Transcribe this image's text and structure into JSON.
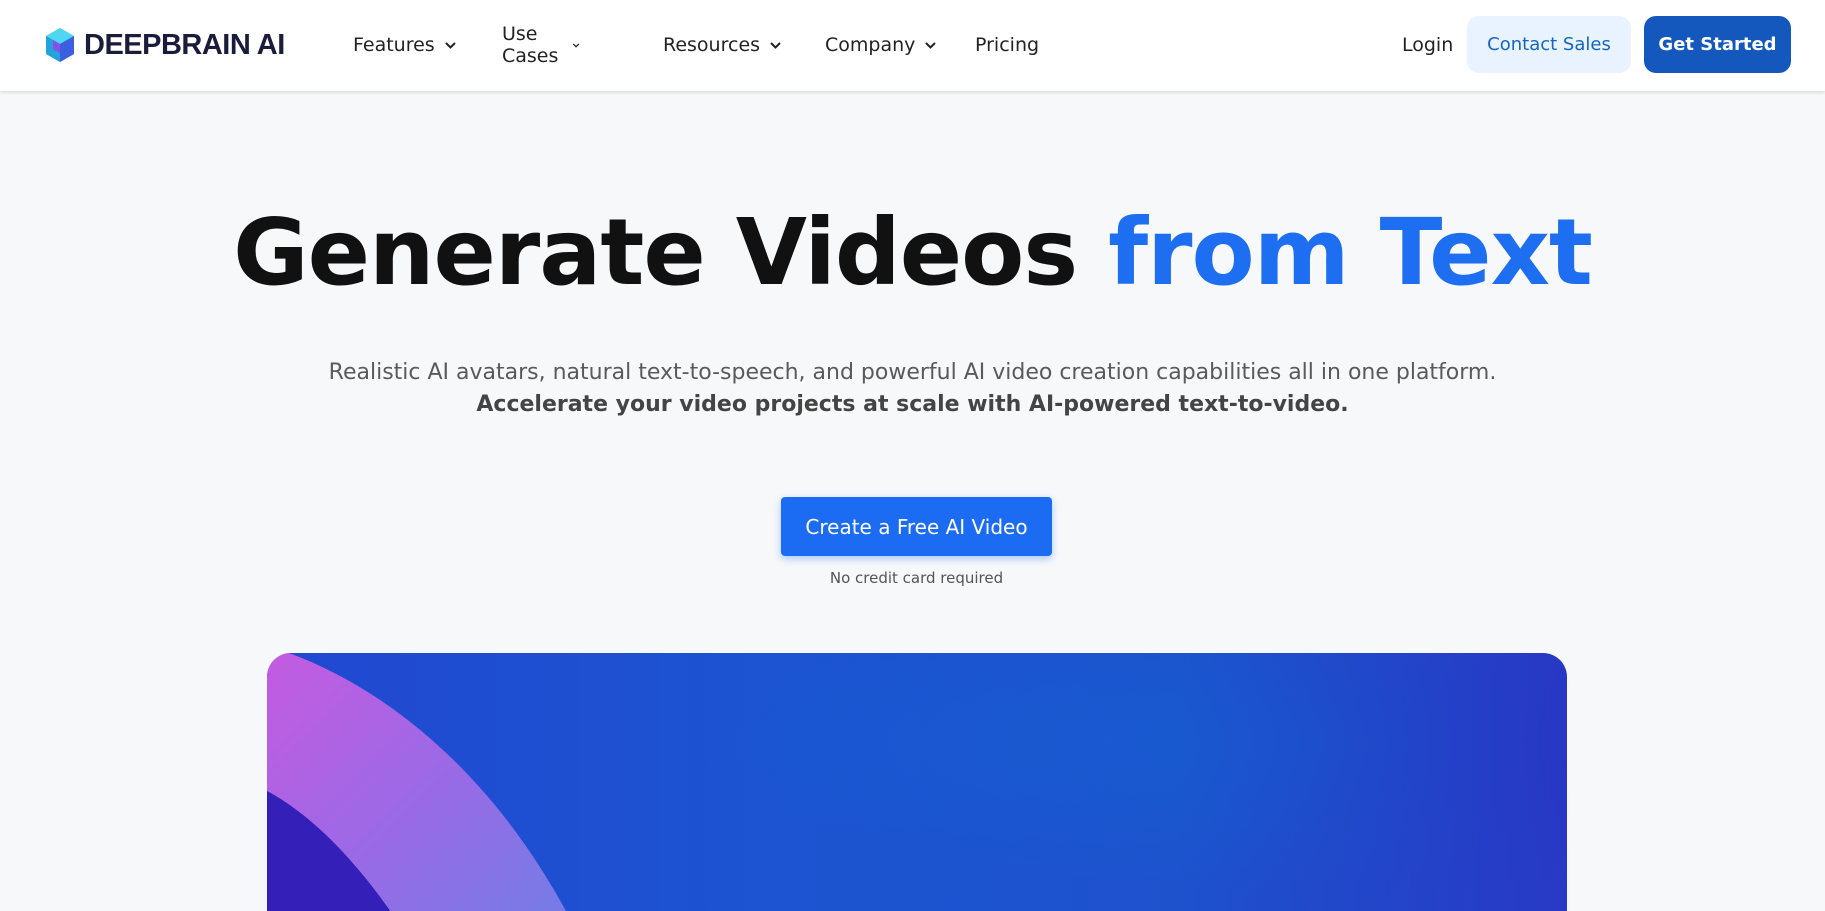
{
  "header": {
    "brand": "DEEPBRAIN AI",
    "logo_icon": "cube-logo-icon",
    "nav": [
      {
        "label": "Features",
        "has_dropdown": true
      },
      {
        "label": "Use Cases",
        "has_dropdown": true
      },
      {
        "label": "Resources",
        "has_dropdown": true
      },
      {
        "label": "Company",
        "has_dropdown": true
      },
      {
        "label": "Pricing",
        "has_dropdown": false
      }
    ],
    "login_label": "Login",
    "contact_sales_label": "Contact Sales",
    "get_started_label": "Get Started"
  },
  "hero": {
    "title_main": "Generate Videos ",
    "title_accent": "from Text",
    "subtitle": "Realistic AI avatars, natural text-to-speech, and powerful AI video creation capabilities all in one platform.",
    "subtitle_strong": "Accelerate your video projects at scale with AI-powered text-to-video.",
    "cta_label": "Create a Free AI Video",
    "cta_note": "No credit card required"
  },
  "colors": {
    "accent": "#1d6ef0",
    "cta": "#1b6cf2",
    "get_started": "#1457bd",
    "contact_bg": "#e8f3ff",
    "contact_text": "#1565c0",
    "page_bg": "#f7f8fa"
  }
}
